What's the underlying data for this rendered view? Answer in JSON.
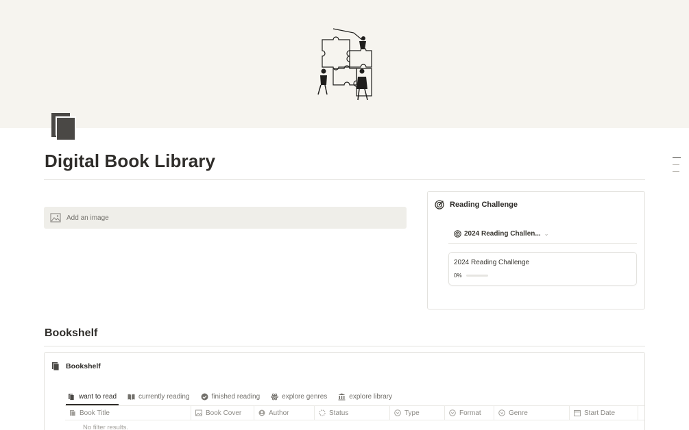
{
  "page": {
    "title": "Digital Book Library",
    "cover_icon": "puzzle-illustration",
    "page_icon": "book-icon"
  },
  "image_block": {
    "label": "Add an image",
    "icon": "image-icon"
  },
  "reading_challenge": {
    "heading": "Reading Challenge",
    "heading_icon": "target-icon",
    "view_label": "2024 Reading Challen...",
    "view_icon": "target-icon",
    "card": {
      "title": "2024 Reading Challenge",
      "percent_label": "0%",
      "progress": 0
    }
  },
  "bookshelf_section": {
    "heading": "Bookshelf"
  },
  "database": {
    "title": "Bookshelf",
    "title_icon": "book-icon",
    "tabs": [
      {
        "label": "want to read",
        "icon": "book-icon",
        "active": true
      },
      {
        "label": "currently reading",
        "icon": "open-book-icon",
        "active": false
      },
      {
        "label": "finished reading",
        "icon": "check-circle-icon",
        "active": false
      },
      {
        "label": "explore genres",
        "icon": "atom-icon",
        "active": false
      },
      {
        "label": "explore library",
        "icon": "library-icon",
        "active": false
      }
    ],
    "columns": [
      {
        "label": "Book Title",
        "icon": "text-icon"
      },
      {
        "label": "Book Cover",
        "icon": "image-icon"
      },
      {
        "label": "Author",
        "icon": "person-icon"
      },
      {
        "label": "Status",
        "icon": "status-icon"
      },
      {
        "label": "Type",
        "icon": "select-icon"
      },
      {
        "label": "Format",
        "icon": "select-icon"
      },
      {
        "label": "Genre",
        "icon": "select-icon"
      },
      {
        "label": "Start Date",
        "icon": "calendar-icon"
      }
    ],
    "empty_text": "No filter results."
  },
  "colors": {
    "cover_bg": "#f6f4ef",
    "text": "#37352f",
    "muted": "#73716c"
  }
}
